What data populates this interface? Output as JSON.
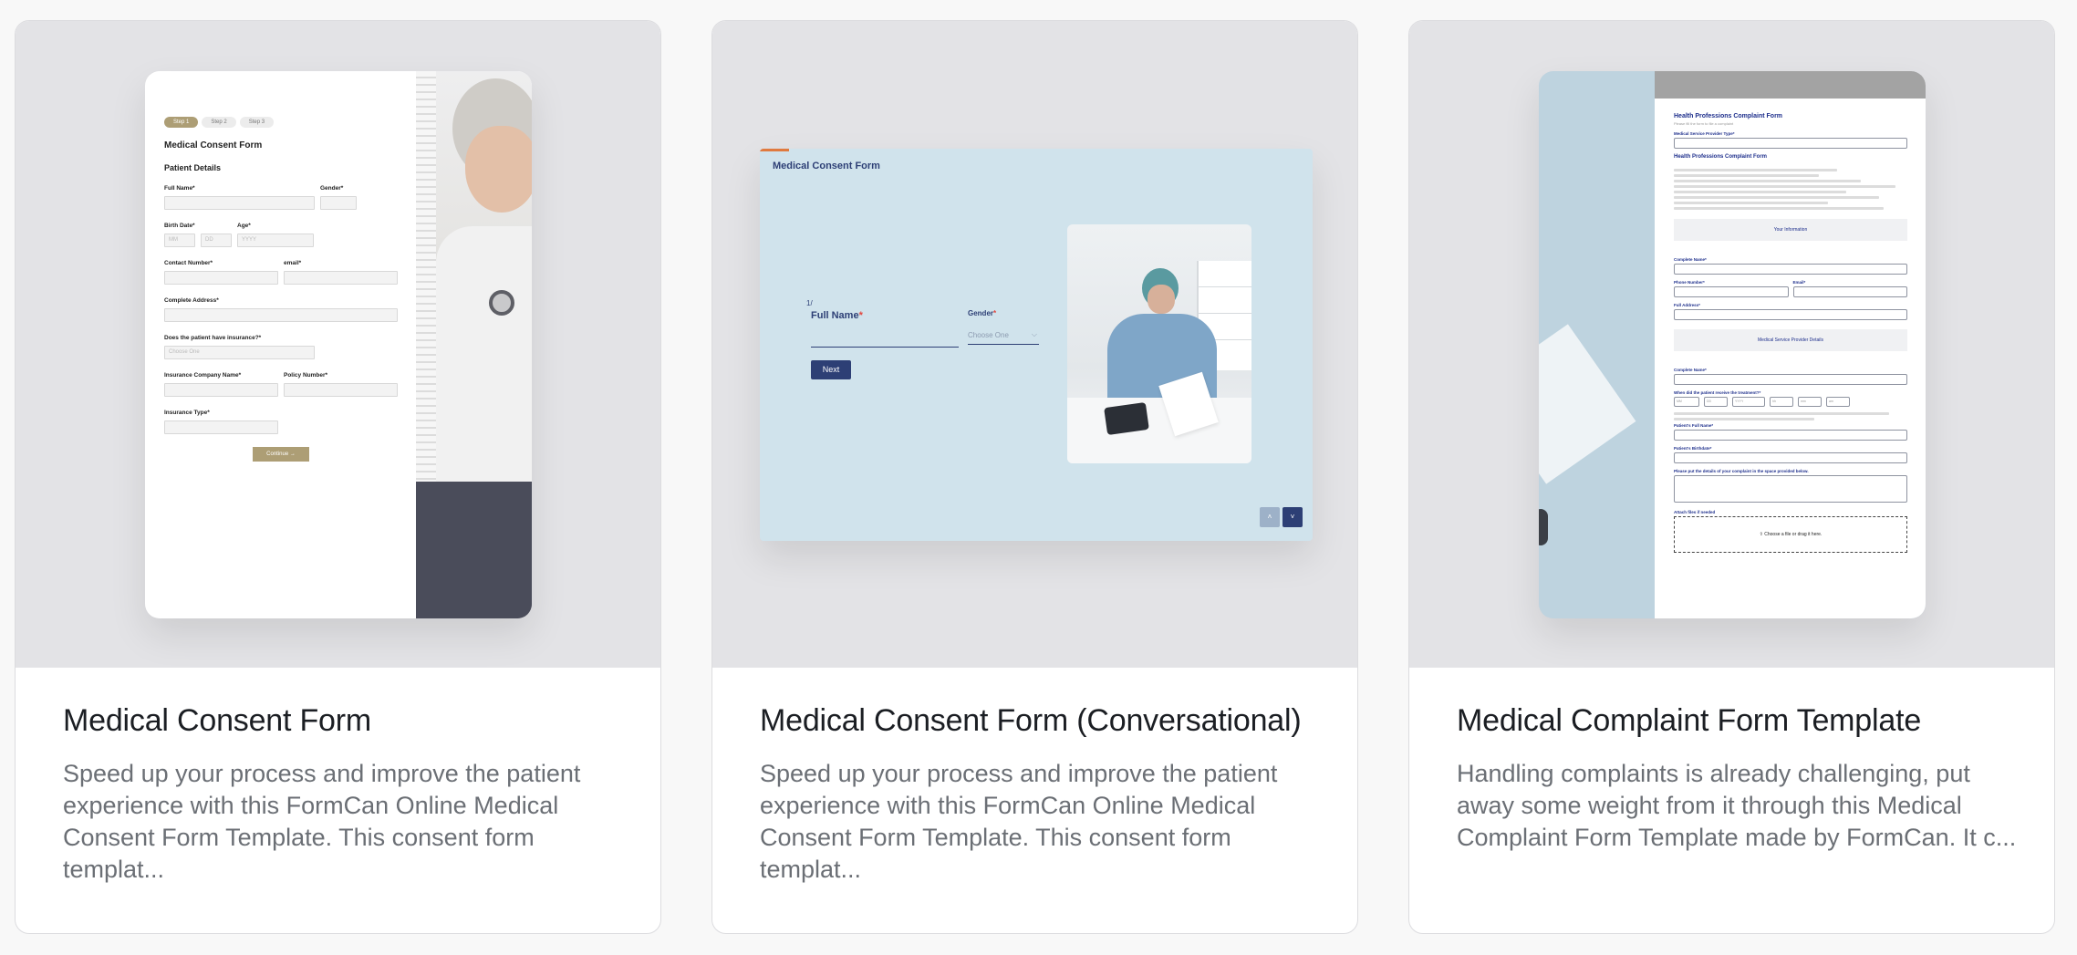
{
  "cards": [
    {
      "title": "Medical Consent Form",
      "description": "Speed up your process and improve the patient experience with this FormCan Online Medical Consent Form Template. This consent form templat...",
      "preview": {
        "steps": [
          "Step 1",
          "Step 2",
          "Step 3"
        ],
        "form_title": "Medical Consent Form",
        "section": "Patient Details",
        "labels": {
          "full_name": "Full Name*",
          "gender": "Gender*",
          "birth_date": "Birth Date*",
          "age": "Age*",
          "contact": "Contact Number*",
          "email": "email*",
          "address": "Complete Address*",
          "insurance_q": "Does the patient have insurance?*",
          "insurance_company": "Insurance Company Name*",
          "policy": "Policy Number*",
          "insurance_type": "Insurance Type*"
        },
        "placeholders": {
          "mm": "MM",
          "dd": "DD",
          "yyyy": "YYYY",
          "choose": "Choose One"
        },
        "continue_label": "Continue →"
      }
    },
    {
      "title": "Medical Consent Form (Conversational)",
      "description": "Speed up your process and improve the patient experience with this FormCan Online Medical Consent Form Template. This consent form templat...",
      "preview": {
        "header_title": "Medical Consent Form",
        "question_number": "1/",
        "question_label": "Full Name",
        "required_mark": "*",
        "gender_label": "Gender",
        "gender_placeholder": "Choose One",
        "next_label": "Next",
        "nav_up": "˄",
        "nav_down": "˅"
      }
    },
    {
      "title": "Medical Complaint Form Template",
      "description": "Handling complaints is already challenging, put away some weight from it through this Medical Complaint Form Template made by FormCan. It c...",
      "preview": {
        "form_title": "Health Professions Complaint Form",
        "subtitle": "Please fill the form to file a complaint",
        "provider_type_label": "Medical Service Provider Type*",
        "section_title": "Health Professions Complaint Form",
        "band_your_info": "Your Information",
        "complete_name": "Complete Name*",
        "phone": "Phone Number*",
        "email": "Email*",
        "full_address": "Full Address*",
        "band_provider": "Medical Service Provider Details",
        "when_label": "When did the patient receive the treatment?*",
        "date_parts": [
          "MM",
          "DD",
          "YYYY",
          "hh",
          "mm",
          "am"
        ],
        "patient_name": "Patient's Full Name*",
        "patient_birthdate": "Patient's Birthdate*",
        "details_label": "Please put the details of your complaint in the space provided below.",
        "attach_label": "Attach files if needed",
        "drop_text": "⇧ Choose a file or drag it here."
      }
    }
  ]
}
